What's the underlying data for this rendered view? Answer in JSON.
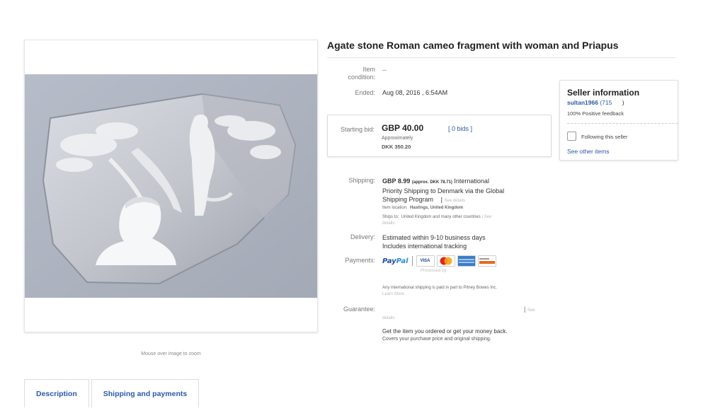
{
  "listing": {
    "title": "Agate stone Roman cameo fragment with woman and Priapus",
    "zoom_hint": "Mouse over image to zoom"
  },
  "details": {
    "condition_label": "Item condition:",
    "condition_label_1": "Item",
    "condition_label_2": "condition:",
    "condition_value": "--",
    "ended_label": "Ended:",
    "ended_value": "Aug 08, 2016 , 6:54AM",
    "starting_bid_label": "Starting bid:",
    "starting_bid_value": "GBP 40.00",
    "bids_link": "[ 0 bids ]",
    "approx_label": "Approximately",
    "approx_value": "DKK 350.20",
    "shipping_label": "Shipping:",
    "shipping_price": "GBP 8.99",
    "shipping_approx": "(approx. DKK 78.71)",
    "shipping_desc_1": "International",
    "shipping_desc_2": "Priority Shipping to Denmark  via the Global",
    "shipping_desc_3": "Shipping Program",
    "see_details": "See details",
    "item_location_label": "Item location:",
    "item_location_value": "Hastings, United Kingdom",
    "ships_to_label": "Ships to:",
    "ships_to_value": "United Kingdom and many other countries",
    "ships_see": "| See",
    "ships_details": "details",
    "delivery_label": "Delivery:",
    "delivery_1": "Estimated within 9-10 business days",
    "delivery_2": "Includes international tracking",
    "payments_label": "Payments:",
    "paypal_a": "Pay",
    "paypal_b": "Pal",
    "processed_by": "Processed by",
    "pitney_note": "Any international shipping is paid in part to Pitney Bowes Inc.",
    "learn_more": "Learn More",
    "guarantee_label": "Guarantee:",
    "guarantee_see": "See",
    "guarantee_details": "details",
    "guarantee_1": "Get the item you ordered or get your money back.",
    "guarantee_2": "Covers your purchase price and original shipping."
  },
  "cards": [
    "VISA",
    "",
    "",
    ""
  ],
  "seller": {
    "title": "Seller information",
    "name": "sultan1966",
    "score": "(715",
    "score_close": ")",
    "feedback": "100% Positive feedback",
    "follow_label": "Following this seller",
    "see_other": "See other items"
  },
  "tabs": [
    "Description",
    "Shipping and payments"
  ],
  "colors": {
    "link": "#2b5aa6",
    "photo_bg": "#aeb3c0"
  }
}
